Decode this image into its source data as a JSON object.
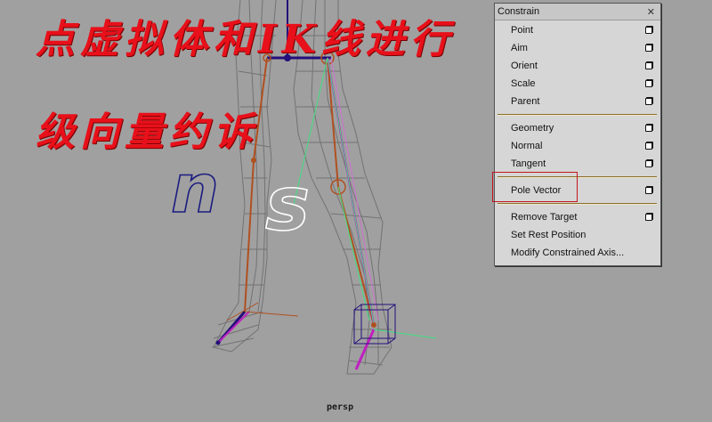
{
  "viewport": {
    "camera_label": "persp",
    "overlay_text": [
      "点虚拟体和IK线进行",
      "级向量约诉"
    ],
    "text_curves": [
      "n",
      "s"
    ],
    "colors": {
      "background": "#a0a0a0",
      "overlay_text": "#e8101a",
      "skeleton": "#b05020",
      "ik_handle": "#c020c0",
      "pole_line": "#40e080",
      "curve_n": "#1a1a80",
      "curve_s": "#ffffff"
    }
  },
  "menu": {
    "title": "Constrain",
    "close_icon": "close-x-icon",
    "items": [
      {
        "label": "Point",
        "has_options": true
      },
      {
        "label": "Aim",
        "has_options": true
      },
      {
        "label": "Orient",
        "has_options": true
      },
      {
        "label": "Scale",
        "has_options": true
      },
      {
        "label": "Parent",
        "has_options": true
      },
      {
        "label": "Geometry",
        "has_options": true
      },
      {
        "label": "Normal",
        "has_options": true
      },
      {
        "label": "Tangent",
        "has_options": true
      },
      {
        "label": "Pole Vector",
        "has_options": true,
        "highlighted": true
      },
      {
        "label": "Remove Target",
        "has_options": true
      },
      {
        "label": "Set Rest Position",
        "has_options": false
      },
      {
        "label": "Modify Constrained Axis...",
        "has_options": false
      }
    ],
    "highlight_color": "#c0161c"
  }
}
